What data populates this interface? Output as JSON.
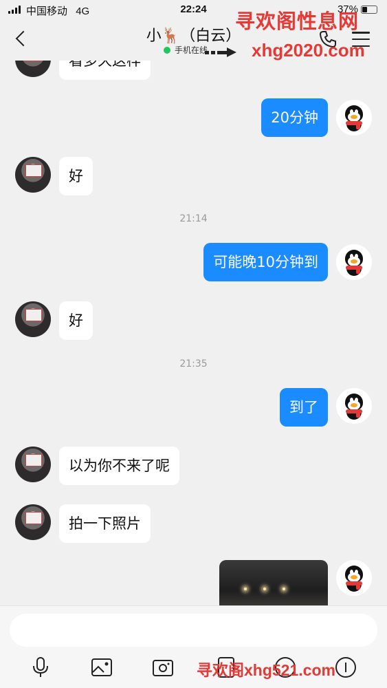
{
  "status_bar": {
    "carrier": "中国移动",
    "network": "4G",
    "time": "22:24",
    "battery_percent": "37%",
    "battery_level": 0.37
  },
  "header": {
    "title": "小🦌（白云）",
    "status": "手机在线"
  },
  "watermarks": {
    "top_text": "寻欢阁性息网",
    "top_url": "xhg2020.com",
    "bottom": "寻欢阁xhg521.com"
  },
  "messages": [
    {
      "side": "in",
      "text": "看多久这样"
    },
    {
      "side": "out",
      "text": "20分钟"
    },
    {
      "side": "in",
      "text": "好"
    },
    {
      "type": "time",
      "text": "21:14"
    },
    {
      "side": "out",
      "text": "可能晚10分钟到"
    },
    {
      "side": "in",
      "text": "好"
    },
    {
      "type": "time",
      "text": "21:35"
    },
    {
      "side": "out",
      "text": "到了"
    },
    {
      "side": "in",
      "text": "以为你不来了呢"
    },
    {
      "side": "in",
      "text": "拍一下照片"
    },
    {
      "side": "out",
      "type": "image"
    }
  ],
  "input": {
    "placeholder": "",
    "value": ""
  },
  "toolbar": [
    "mic-icon",
    "image-icon",
    "camera-icon",
    "more-icon",
    "emoji-icon",
    "plus-icon"
  ],
  "colors": {
    "outgoing_bubble": "#1a8cff",
    "incoming_bubble": "#ffffff",
    "background": "#f0f0f0",
    "watermark": "#e53935",
    "online": "#22c55e"
  }
}
